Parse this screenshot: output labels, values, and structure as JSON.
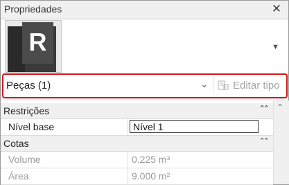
{
  "panel": {
    "title": "Propriedades",
    "close_glyph": "✕"
  },
  "type_selector": {
    "logo_letter": "R",
    "dropdown_glyph": "▼"
  },
  "element_selector": {
    "label": "Peças (1)",
    "chevron": "⌄",
    "edit_type_label": "Editar tipo"
  },
  "categories": [
    {
      "label": "Restrições",
      "collapse_glyph": "⌃⌃",
      "properties": [
        {
          "name": "Nível base",
          "value": "Nível 1",
          "editable": true
        }
      ]
    },
    {
      "label": "Cotas",
      "collapse_glyph": "⌃⌃",
      "properties": [
        {
          "name": "Volume",
          "value": "0.225 m³",
          "editable": false
        },
        {
          "name": "Área",
          "value": "9.000 m²",
          "editable": false
        }
      ]
    }
  ],
  "scrollbar": {
    "up_glyph": "⌃"
  },
  "colors": {
    "highlight_border": "#d11a1a",
    "disabled_text": "#a4a4a4"
  }
}
